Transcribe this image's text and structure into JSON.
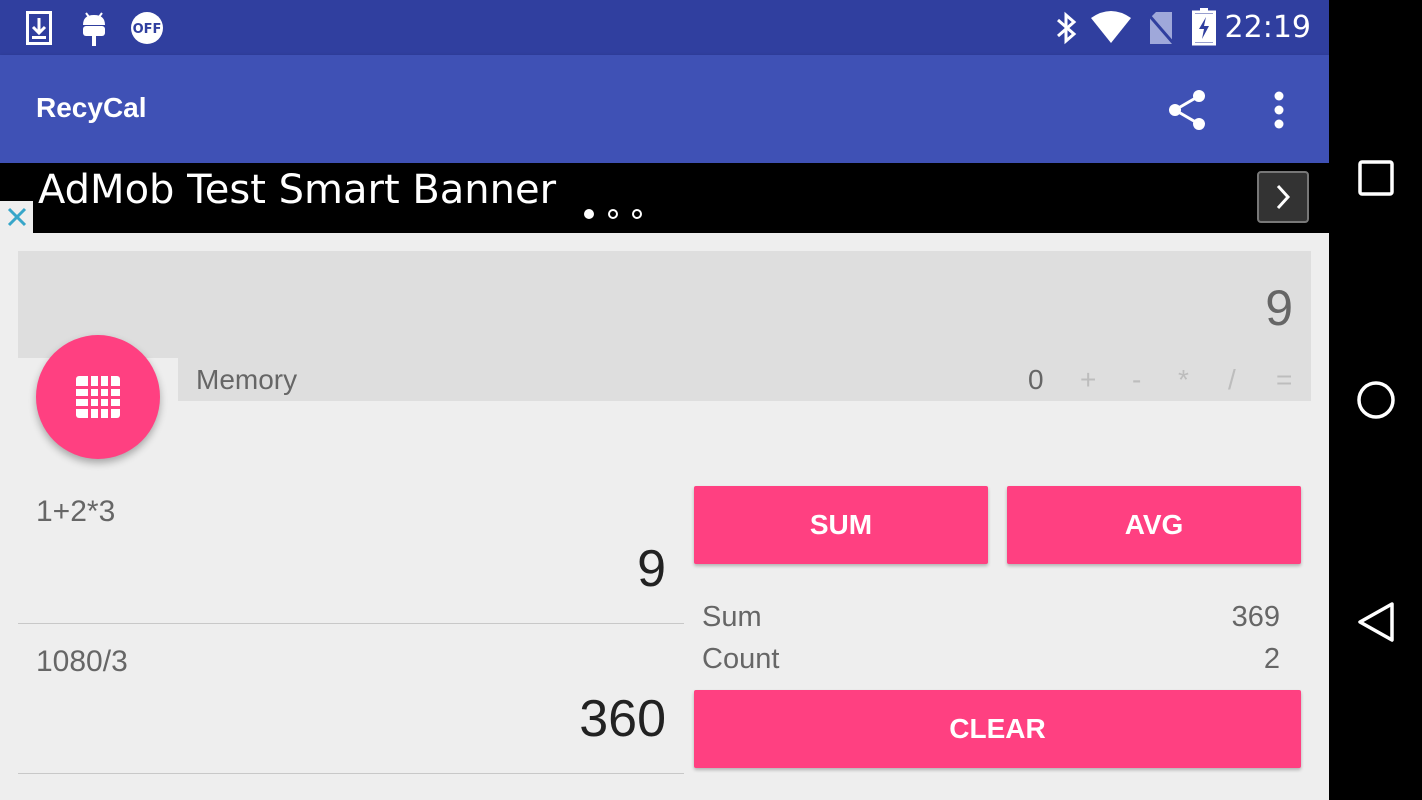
{
  "status_bar": {
    "time": "22:19",
    "left_icons": [
      "download-icon",
      "android-debug-icon",
      "off-badge-icon"
    ],
    "off_badge": "OFF",
    "right_icons": [
      "bluetooth-icon",
      "wifi-icon",
      "no-sim-icon",
      "battery-charging-icon"
    ]
  },
  "app_bar": {
    "title": "RecyCal",
    "actions": [
      "share-icon",
      "overflow-menu-icon"
    ]
  },
  "ad_banner": {
    "text": "AdMob Test Smart Banner",
    "page_count": 3,
    "current_page": 1
  },
  "display": {
    "value": "9"
  },
  "memory": {
    "label": "Memory",
    "value": "0",
    "ops": [
      "+",
      "-",
      "*",
      "/",
      "="
    ]
  },
  "history": [
    {
      "expression": "1+2*3",
      "result": "9"
    },
    {
      "expression": "1080/3",
      "result": "360"
    }
  ],
  "actions": {
    "sum_label": "SUM",
    "avg_label": "AVG",
    "clear_label": "CLEAR"
  },
  "stats": {
    "sum_label": "Sum",
    "sum_value": "369",
    "count_label": "Count",
    "count_value": "2"
  },
  "colors": {
    "status_bar": "#303f9f",
    "app_bar": "#3f51b5",
    "accent": "#ff4081"
  }
}
